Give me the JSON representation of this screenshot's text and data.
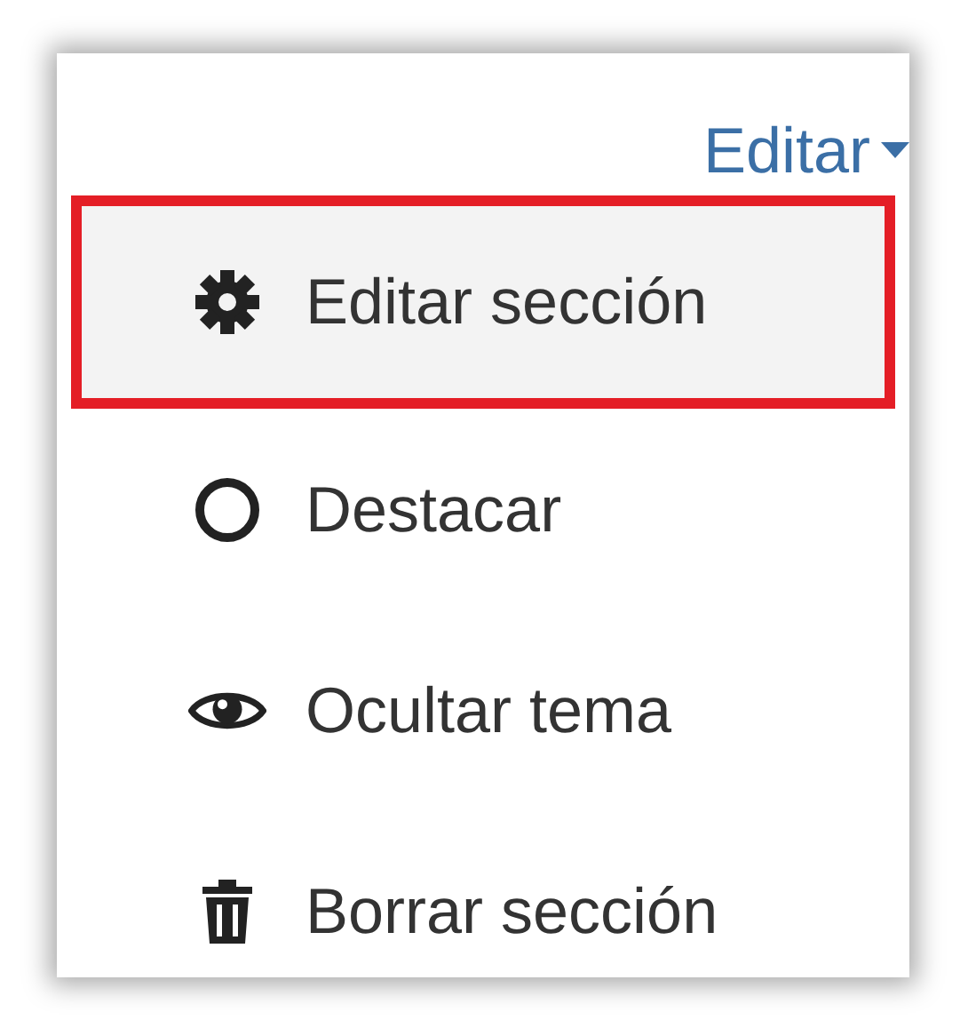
{
  "menu": {
    "toggle": {
      "label": "Editar",
      "expanded": true
    },
    "items": [
      {
        "label": "Editar sección",
        "selected": true
      },
      {
        "label": "Destacar",
        "selected": false
      },
      {
        "label": "Ocultar tema",
        "selected": false
      },
      {
        "label": "Borrar sección",
        "selected": false
      }
    ]
  }
}
